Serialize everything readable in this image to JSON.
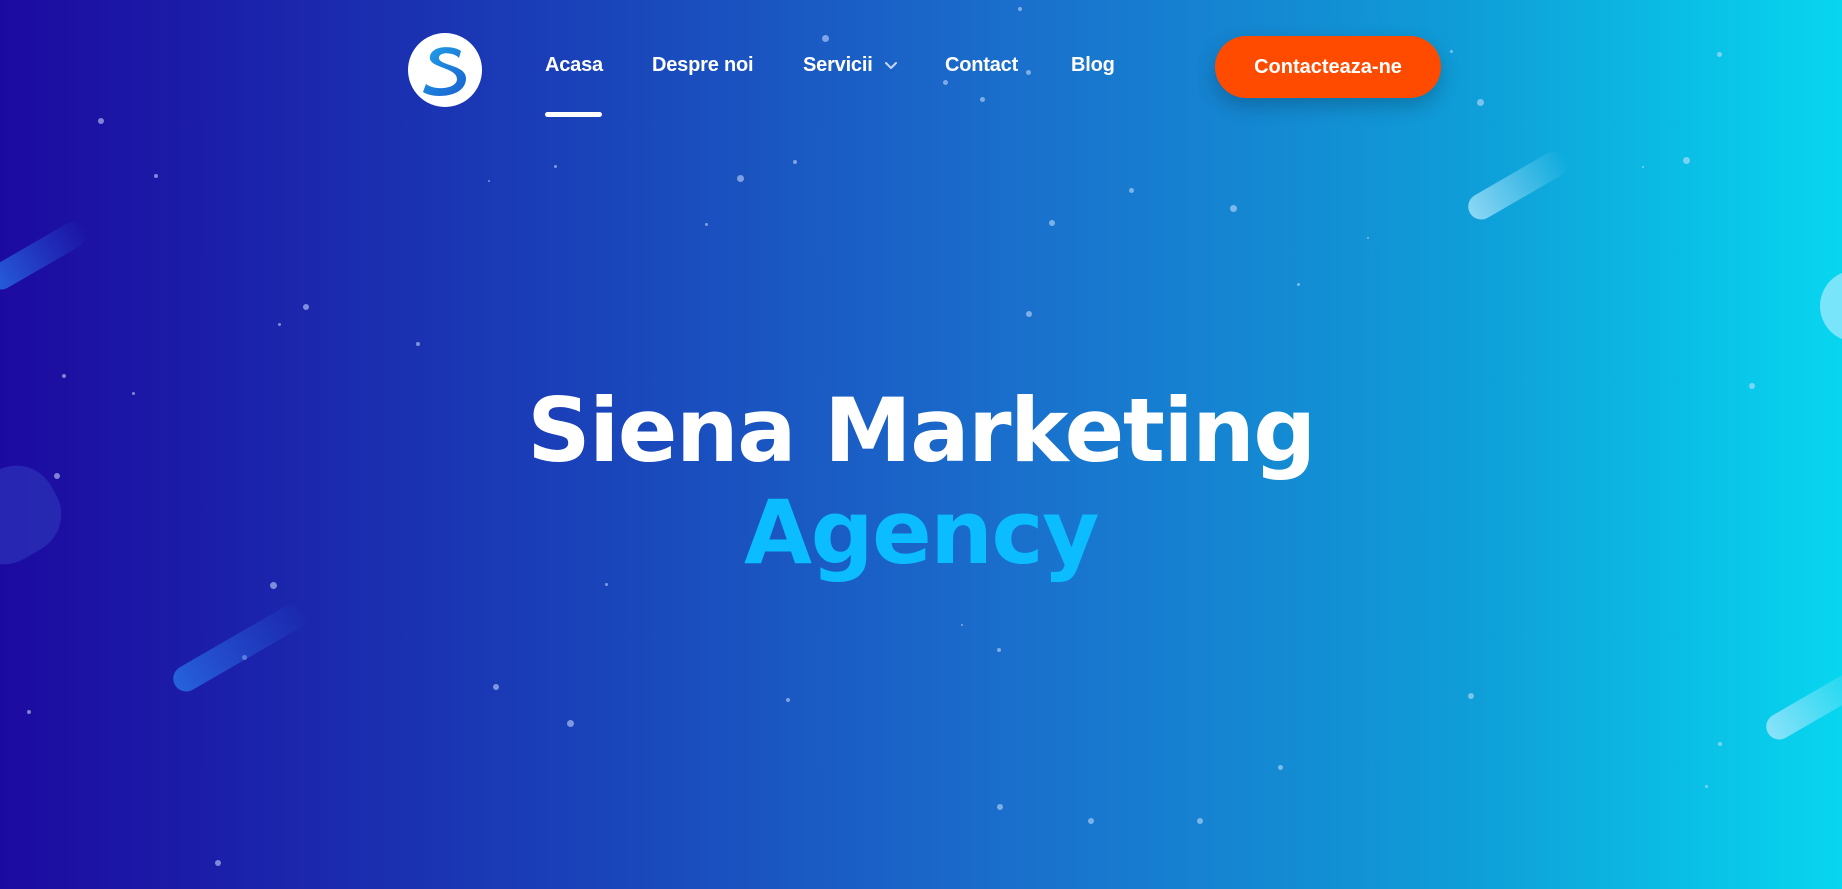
{
  "brand": {
    "logo_icon": "siena-s-logo-icon",
    "logo_letter": "S",
    "colors": {
      "accent_orange": "#ff4b00",
      "highlight_blue": "#0bbcff",
      "gradient_start": "#1c0aa0",
      "gradient_end": "#07d6ef"
    }
  },
  "nav": {
    "items": [
      {
        "label": "Acasa",
        "active": true
      },
      {
        "label": "Despre noi",
        "active": false
      },
      {
        "label": "Servicii",
        "active": false,
        "has_dropdown": true,
        "dropdown_icon": "chevron-down-icon"
      },
      {
        "label": "Contact",
        "active": false
      },
      {
        "label": "Blog",
        "active": false
      }
    ],
    "cta_label": "Contacteaza-ne"
  },
  "hero": {
    "title_line1": "Siena Marketing",
    "title_line2": "Agency"
  }
}
